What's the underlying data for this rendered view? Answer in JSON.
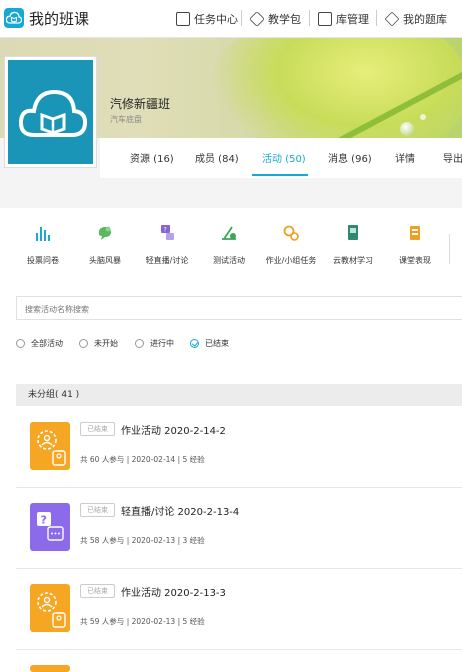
{
  "app": {
    "title": "我的班课",
    "logo_icon": "cloud-book-icon",
    "accent": "#17a8d5"
  },
  "topnav": {
    "items": [
      {
        "label": "任务中心",
        "icon": "task-icon"
      },
      {
        "label": "教学包",
        "icon": "package-icon"
      },
      {
        "label": "库管理",
        "icon": "library-icon"
      },
      {
        "label": "我的题库",
        "icon": "question-bank-icon"
      }
    ]
  },
  "class": {
    "name": "汽修新疆班",
    "subtitle": "汽车底盘",
    "avatar_icon": "cloud-book-icon"
  },
  "tabs": {
    "items": [
      {
        "label": "资源 (16)"
      },
      {
        "label": "成员 (84)"
      },
      {
        "label": "活动 (50)",
        "active": true
      },
      {
        "label": "消息 (96)"
      },
      {
        "label": "详情"
      },
      {
        "label": "导出"
      }
    ]
  },
  "tools": {
    "items": [
      {
        "label": "投票问卷",
        "icon": "vote-icon",
        "color": "#17a8d5"
      },
      {
        "label": "头脑风暴",
        "icon": "brainstorm-icon",
        "color": "#5cb85c"
      },
      {
        "label": "轻直播/讨论",
        "icon": "live-discussion-icon",
        "color": "#8a63d2"
      },
      {
        "label": "测试活动",
        "icon": "test-icon",
        "color": "#3aa657"
      },
      {
        "label": "作业/小组任务",
        "icon": "homework-icon",
        "color": "#f0a020"
      },
      {
        "label": "云教材学习",
        "icon": "textbook-icon",
        "color": "#2d8a6e"
      },
      {
        "label": "课堂表现",
        "icon": "performance-icon",
        "color": "#f0a020"
      }
    ]
  },
  "search": {
    "placeholder": "搜索活动名称搜索",
    "value": ""
  },
  "filters": {
    "items": [
      {
        "label": "全部活动",
        "checked": false
      },
      {
        "label": "未开始",
        "checked": false
      },
      {
        "label": "进行中",
        "checked": false
      },
      {
        "label": "已结束",
        "checked": true
      }
    ]
  },
  "group": {
    "label": "未分组( 41 )"
  },
  "activities": [
    {
      "status": "已结束",
      "title": "作业活动 2020-2-14-2",
      "meta": "共 60 人参与  |  2020-02-14  |  5 经验",
      "type_icon": "homework-icon",
      "color": "#f5a623"
    },
    {
      "status": "已结束",
      "title": "轻直播/讨论 2020-2-13-4",
      "meta": "共 58 人参与  |  2020-02-13  |  3 经验",
      "type_icon": "live-discussion-icon",
      "color": "#8b6bea"
    },
    {
      "status": "已结束",
      "title": "作业活动 2020-2-13-3",
      "meta": "共 59 人参与  |  2020-02-13  |  5 经验",
      "type_icon": "homework-icon",
      "color": "#f5a623"
    }
  ]
}
